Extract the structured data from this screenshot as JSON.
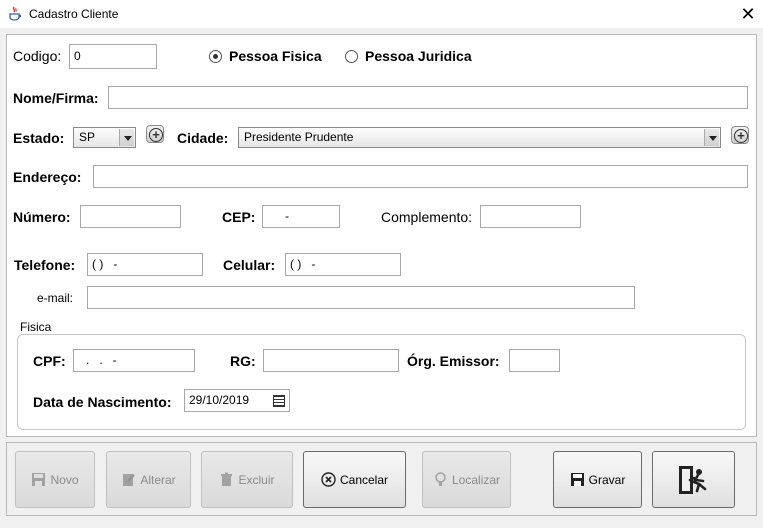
{
  "window": {
    "title": "Cadastro Cliente",
    "close_label": "✕"
  },
  "form": {
    "codigo": {
      "label": "Codigo:",
      "value": "0"
    },
    "tipo": {
      "pessoa_fisica": "Pessoa Fisica",
      "pessoa_juridica": "Pessoa Juridica",
      "selected": "Pessoa Fisica"
    },
    "nome": {
      "label": "Nome/Firma:",
      "value": ""
    },
    "estado": {
      "label": "Estado:",
      "value": "SP"
    },
    "cidade": {
      "label": "Cidade:",
      "value": "Presidente Prudente"
    },
    "endereco": {
      "label": "Endereço:",
      "value": ""
    },
    "numero": {
      "label": "Número:",
      "value": ""
    },
    "cep": {
      "label": "CEP:",
      "value": "-"
    },
    "complemento": {
      "label": "Complemento:",
      "value": ""
    },
    "telefone": {
      "label": "Telefone:",
      "value": "( )   -"
    },
    "celular": {
      "label": "Celular:",
      "value": "( )   -"
    },
    "email": {
      "label": "e-mail:",
      "value": ""
    }
  },
  "fisica": {
    "title": "Fisica",
    "cpf": {
      "label": "CPF:",
      "value": ".   .   -"
    },
    "rg": {
      "label": "RG:",
      "value": ""
    },
    "orgao": {
      "label": "Órg. Emissor:",
      "value": ""
    },
    "nascimento": {
      "label": "Data de Nascimento:",
      "value": "29/10/2019"
    }
  },
  "buttons": {
    "novo": "Novo",
    "alterar": "Alterar",
    "excluir": "Excluir",
    "cancelar": "Cancelar",
    "localizar": "Localizar",
    "gravar": "Gravar"
  },
  "icons": {
    "app": "java-coffee-icon",
    "novo": "floppy-icon",
    "alterar": "edit-icon",
    "excluir": "trash-icon",
    "cancelar": "cancel-circle-icon",
    "localizar": "lightbulb-icon",
    "gravar": "save-icon",
    "sair": "exit-door-icon"
  }
}
